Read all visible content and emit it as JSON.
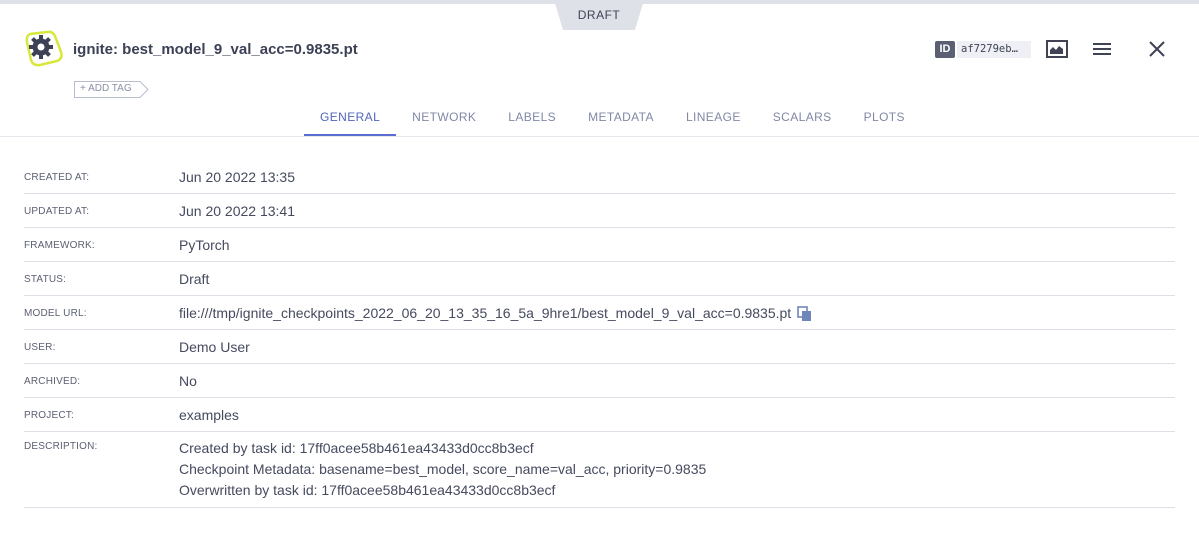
{
  "draft_label": "DRAFT",
  "header": {
    "title": "ignite: best_model_9_val_acc=0.9835.pt",
    "add_tag_label": "+ ADD TAG",
    "id_badge": "ID",
    "id_value": "af7279eb…"
  },
  "tabs": [
    {
      "label": "GENERAL",
      "active": true
    },
    {
      "label": "NETWORK",
      "active": false
    },
    {
      "label": "LABELS",
      "active": false
    },
    {
      "label": "METADATA",
      "active": false
    },
    {
      "label": "LINEAGE",
      "active": false
    },
    {
      "label": "SCALARS",
      "active": false
    },
    {
      "label": "PLOTS",
      "active": false
    }
  ],
  "details": {
    "created_at": {
      "label": "CREATED AT:",
      "value": "Jun 20 2022 13:35"
    },
    "updated_at": {
      "label": "UPDATED AT:",
      "value": "Jun 20 2022 13:41"
    },
    "framework": {
      "label": "FRAMEWORK:",
      "value": "PyTorch"
    },
    "status": {
      "label": "STATUS:",
      "value": "Draft"
    },
    "model_url": {
      "label": "MODEL URL:",
      "value": "file:///tmp/ignite_checkpoints_2022_06_20_13_35_16_5a_9hre1/best_model_9_val_acc=0.9835.pt"
    },
    "user": {
      "label": "USER:",
      "value": "Demo User"
    },
    "archived": {
      "label": "ARCHIVED:",
      "value": "No"
    },
    "project": {
      "label": "PROJECT:",
      "value": "examples"
    },
    "description": {
      "label": "DESCRIPTION:",
      "lines": [
        "Created by task id: 17ff0acee58b461ea43433d0cc8b3ecf",
        "Checkpoint Metadata: basename=best_model, score_name=val_acc, priority=0.9835",
        "Overwritten by task id: 17ff0acee58b461ea43433d0cc8b3ecf"
      ]
    }
  },
  "colors": {
    "accent": "#5a6ed1",
    "model_icon_ring": "#d8e83a",
    "text": "#3f4353"
  }
}
